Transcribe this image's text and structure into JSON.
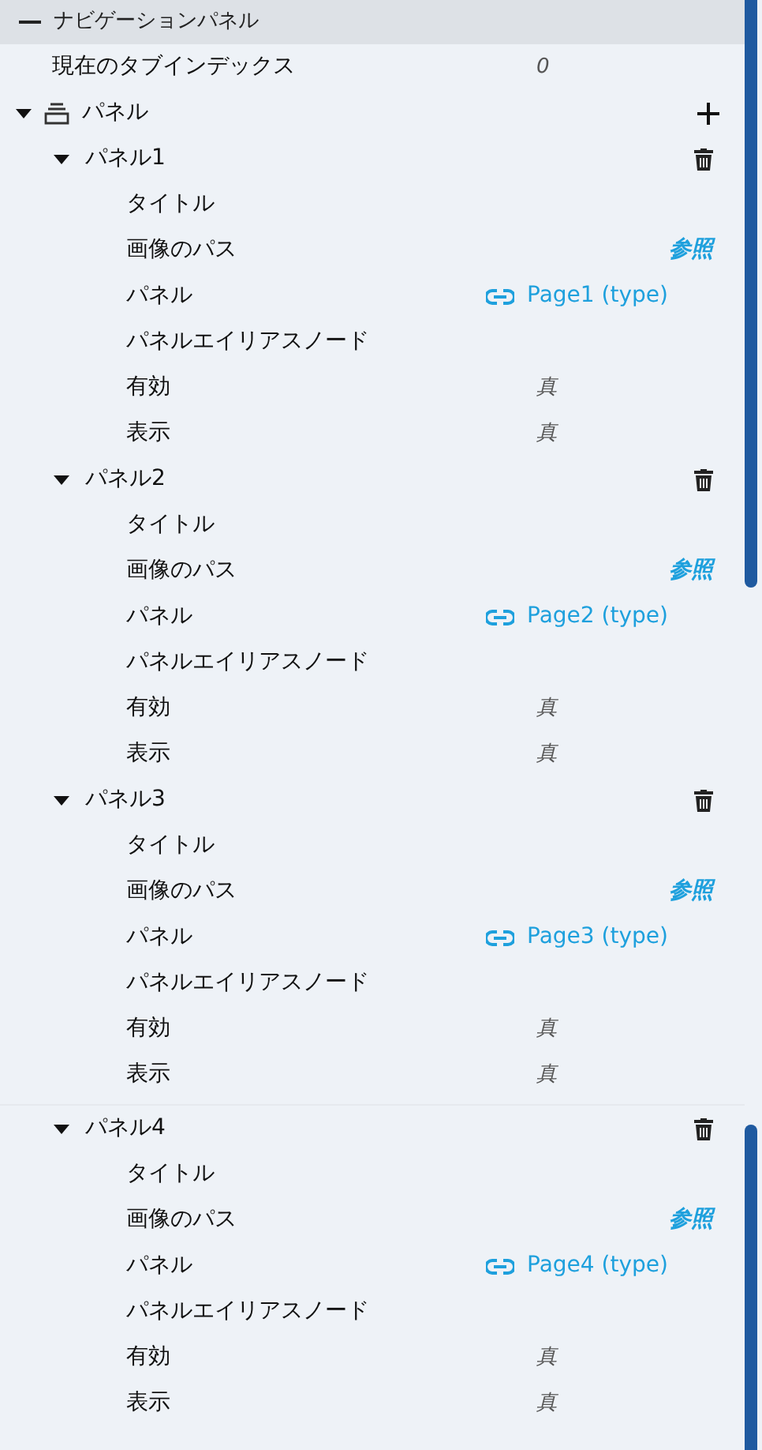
{
  "header": {
    "title": "ナビゲーションパネル",
    "expanded": true
  },
  "current_tab": {
    "label": "現在のタブインデックス",
    "value": "0"
  },
  "panels_group": {
    "label": "パネル",
    "expanded": true,
    "panels": [
      {
        "label": "パネル1",
        "expanded": true,
        "properties": [
          {
            "kind": "text",
            "label": "タイトル"
          },
          {
            "kind": "browse",
            "label": "画像のパス",
            "value": "参照"
          },
          {
            "kind": "link",
            "label": "パネル",
            "value": "Page1 (type)"
          },
          {
            "kind": "text",
            "label": "パネルエイリアスノード"
          },
          {
            "kind": "bool",
            "label": "有効",
            "value": "真"
          },
          {
            "kind": "bool",
            "label": "表示",
            "value": "真"
          }
        ]
      },
      {
        "label": "パネル2",
        "expanded": true,
        "properties": [
          {
            "kind": "text",
            "label": "タイトル"
          },
          {
            "kind": "browse",
            "label": "画像のパス",
            "value": "参照"
          },
          {
            "kind": "link",
            "label": "パネル",
            "value": "Page2 (type)"
          },
          {
            "kind": "text",
            "label": "パネルエイリアスノード"
          },
          {
            "kind": "bool",
            "label": "有効",
            "value": "真"
          },
          {
            "kind": "bool",
            "label": "表示",
            "value": "真"
          }
        ]
      },
      {
        "label": "パネル3",
        "expanded": true,
        "properties": [
          {
            "kind": "text",
            "label": "タイトル"
          },
          {
            "kind": "browse",
            "label": "画像のパス",
            "value": "参照"
          },
          {
            "kind": "link",
            "label": "パネル",
            "value": "Page3 (type)"
          },
          {
            "kind": "text",
            "label": "パネルエイリアスノード"
          },
          {
            "kind": "bool",
            "label": "有効",
            "value": "真"
          },
          {
            "kind": "bool",
            "label": "表示",
            "value": "真"
          }
        ]
      },
      {
        "label": "パネル4",
        "expanded": true,
        "properties": [
          {
            "kind": "text",
            "label": "タイトル"
          },
          {
            "kind": "browse",
            "label": "画像のパス",
            "value": "参照"
          },
          {
            "kind": "link",
            "label": "パネル",
            "value": "Page4 (type)"
          },
          {
            "kind": "text",
            "label": "パネルエイリアスノード"
          },
          {
            "kind": "bool",
            "label": "有効",
            "value": "真"
          },
          {
            "kind": "bool",
            "label": "表示",
            "value": "真"
          }
        ]
      }
    ]
  }
}
